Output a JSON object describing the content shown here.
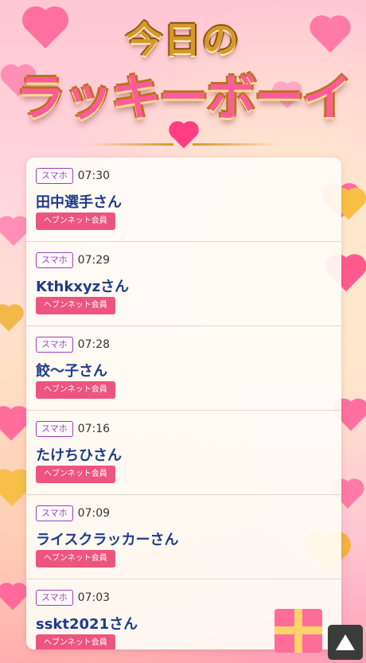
{
  "header": {
    "title_line1": "今日の",
    "title_line2": "ラッキーボーイ"
  },
  "colors": {
    "device_border": "#a13bb7",
    "name_color": "#1e3c8c",
    "badge_bg": "#ee5480",
    "title_gold": "#d49a27",
    "title_pink": "#ff5a9a"
  },
  "items": [
    {
      "device": "スマホ",
      "time": "07:30",
      "name": "田中選手さん",
      "badge": "ヘブンネット会員"
    },
    {
      "device": "スマホ",
      "time": "07:29",
      "name": "Kthkxyzさん",
      "badge": "ヘブンネット会員"
    },
    {
      "device": "スマホ",
      "time": "07:28",
      "name": "餃〜子さん",
      "badge": "ヘブンネット会員"
    },
    {
      "device": "スマホ",
      "time": "07:16",
      "name": "たけちひさん",
      "badge": "ヘブンネット会員"
    },
    {
      "device": "スマホ",
      "time": "07:09",
      "name": "ライスクラッカーさん",
      "badge": "ヘブンネット会員"
    },
    {
      "device": "スマホ",
      "time": "07:03",
      "name": "sskt2021さん",
      "badge": "ヘブンネット会員"
    }
  ],
  "scroll_top": {
    "icon": "triangle-up-icon"
  }
}
